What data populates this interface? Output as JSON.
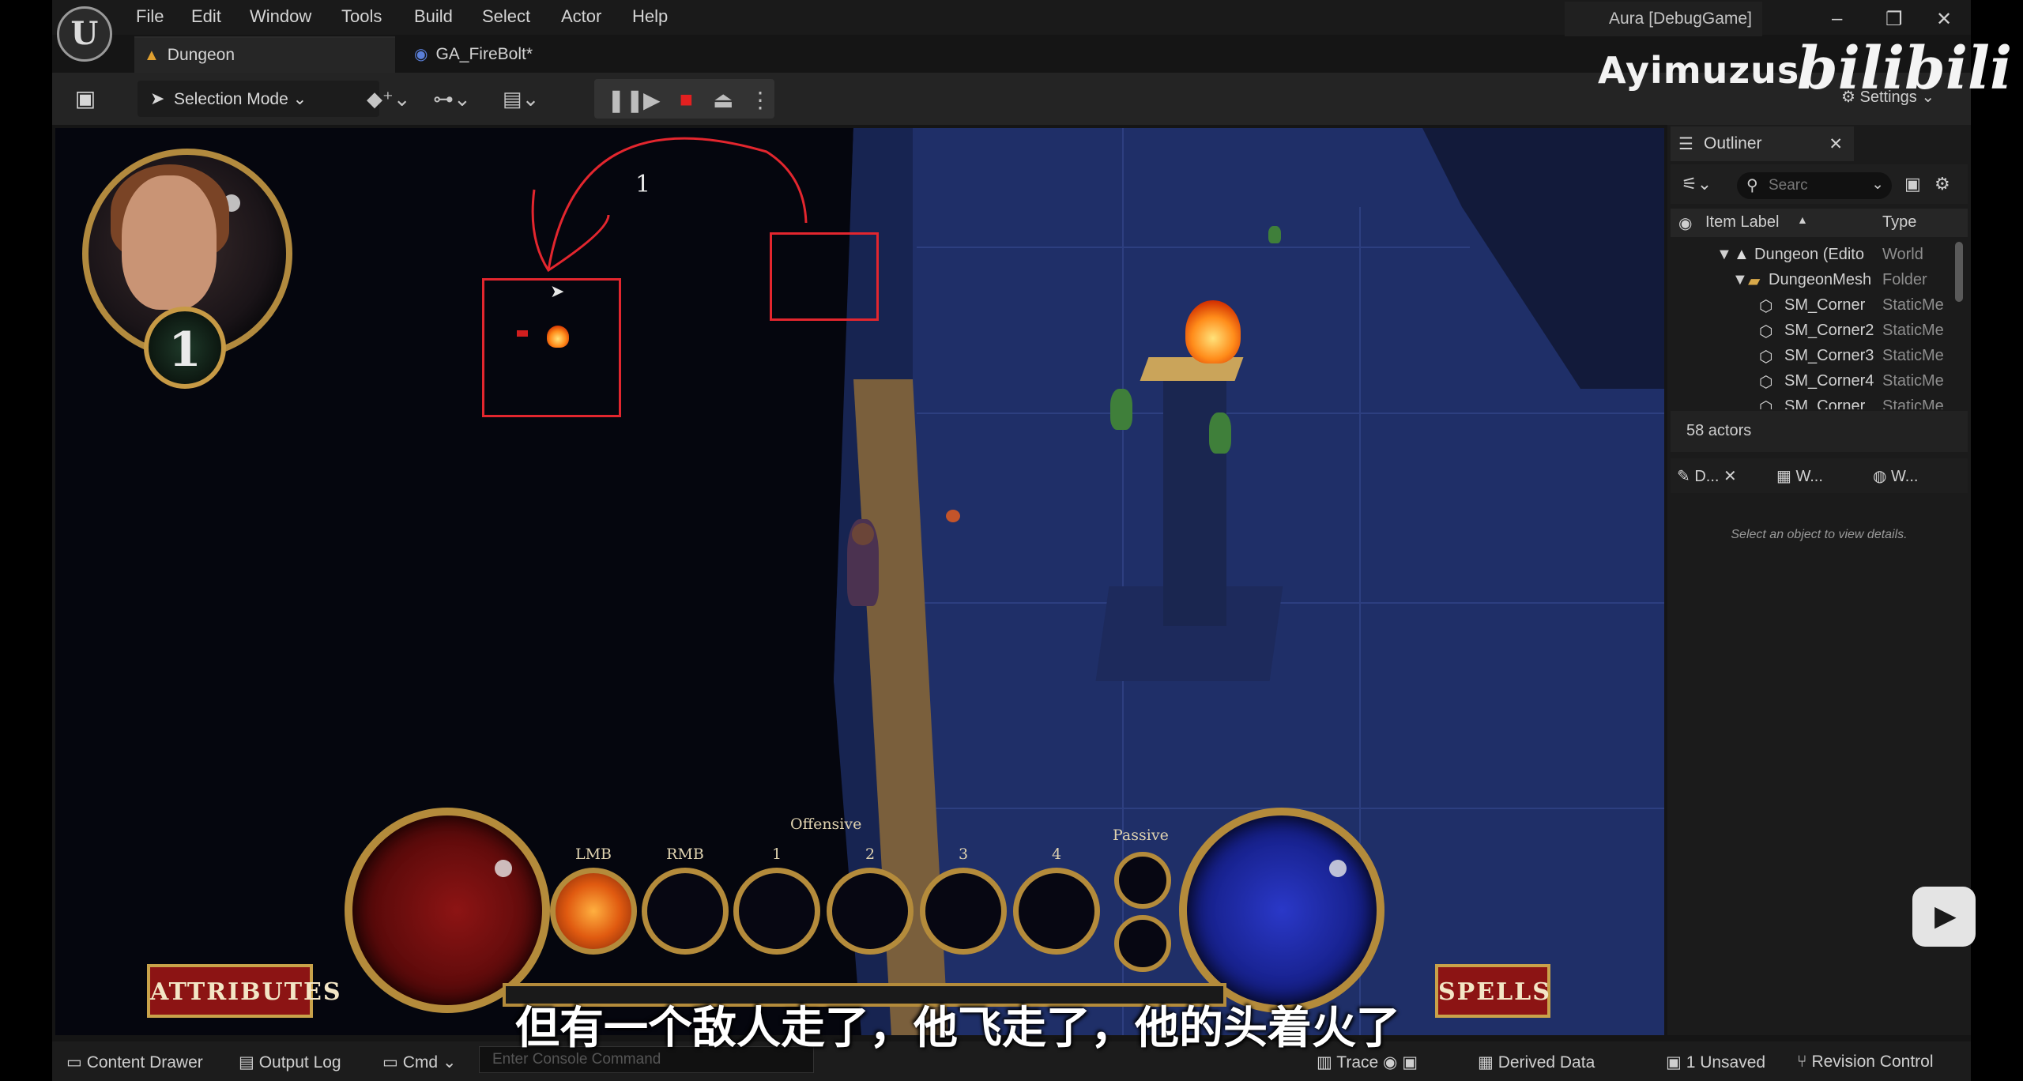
{
  "menu": {
    "items": [
      "File",
      "Edit",
      "Window",
      "Tools",
      "Build",
      "Select",
      "Actor",
      "Help"
    ],
    "window_title": "Aura [DebugGame]",
    "logo_text": "U"
  },
  "tabs": [
    {
      "label": "Dungeon"
    },
    {
      "label": "GA_FireBolt*"
    }
  ],
  "toolbar": {
    "mode_label": "Selection Mode",
    "settings_label": "Settings",
    "save_icon": "save-icon"
  },
  "watermark": {
    "channel": "Ayimuzus",
    "site": "bilibili"
  },
  "annotation": {
    "number": "1"
  },
  "hud": {
    "level": "1",
    "offensive_label": "Offensive",
    "passive_label": "Passive",
    "slot_labels": [
      "LMB",
      "RMB",
      "1",
      "2",
      "3",
      "4"
    ],
    "attributes_label": "ATTRIBUTES",
    "spells_label": "SPELLS"
  },
  "outliner": {
    "tab_label": "Outliner",
    "search_placeholder": "Searc",
    "col_label": "Item Label",
    "col_type": "Type",
    "rows": [
      {
        "label": "Dungeon (Edito",
        "type": "World"
      },
      {
        "label": "DungeonMesh",
        "type": "Folder"
      },
      {
        "label": "SM_Corner",
        "type": "StaticMe"
      },
      {
        "label": "SM_Corner2",
        "type": "StaticMe"
      },
      {
        "label": "SM_Corner3",
        "type": "StaticMe"
      },
      {
        "label": "SM_Corner4",
        "type": "StaticMe"
      },
      {
        "label": "SM_Corner",
        "type": "StaticMe"
      }
    ],
    "actor_count": "58 actors"
  },
  "details": {
    "tabs": [
      "D...",
      "W...",
      "W..."
    ],
    "hint": "Select an object to view details."
  },
  "statusbar": {
    "content_drawer": "Content Drawer",
    "output_log": "Output Log",
    "cmd": "Cmd",
    "console_placeholder": "Enter Console Command",
    "trace": "Trace",
    "derived_data": "Derived Data",
    "unsaved": "1 Unsaved",
    "revision_control": "Revision Control"
  },
  "subtitle": "但有一个敌人走了，他飞走了，他的头着火了",
  "colors": {
    "annotation": "#e3262e",
    "hud_gold": "#b48b3b",
    "health": "#8d1414",
    "mana": "#2a38c8"
  }
}
